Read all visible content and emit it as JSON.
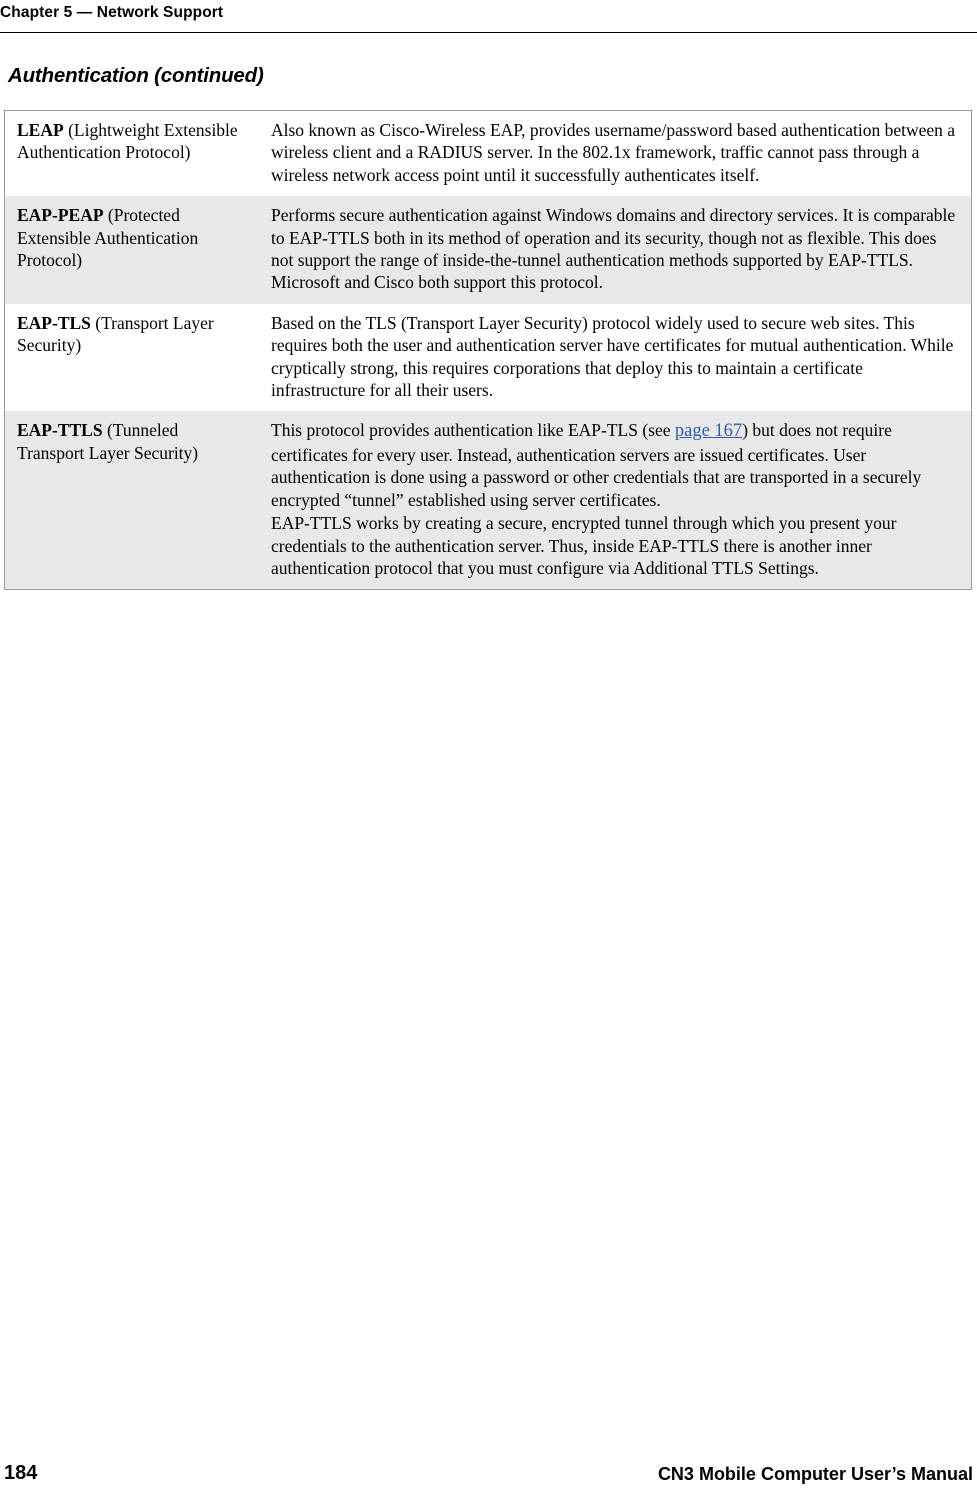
{
  "header": {
    "chapter": "Chapter 5 — Network Support"
  },
  "section": {
    "title": "Authentication (continued)"
  },
  "table": {
    "rows": [
      {
        "term_bold": "LEAP",
        "term_rest": " (Lightweight Extensible Authentication Protocol)",
        "paragraphs": [
          "Also known as Cisco-Wireless EAP, provides username/password based authentication between a wireless client and a RADIUS server. In the 802.1x framework, traffic cannot pass through a wireless network access point until it successfully authenticates itself."
        ],
        "shaded": false
      },
      {
        "term_bold": "EAP-PEAP",
        "term_rest": " (Protected Extensible Authentication Protocol)",
        "paragraphs": [
          "Performs secure authentication against Windows domains and directory services. It is comparable to EAP-TTLS both in its method of operation and its security, though not as flexible. This does not support the range of inside-the-tunnel authentication methods supported by EAP-TTLS. Microsoft and Cisco both support this protocol."
        ],
        "shaded": true
      },
      {
        "term_bold": "EAP-TLS",
        "term_rest": " (Transport Layer Security)",
        "paragraphs": [
          "Based on the TLS (Transport Layer Security) protocol widely used to secure web sites. This requires both the user and authentication server have certificates for mutual authentication. While cryptically strong, this requires corporations that deploy this to maintain a certificate infrastructure for all their users."
        ],
        "shaded": false
      },
      {
        "term_bold": "EAP-TTLS",
        "term_rest": " (Tunneled Transport Layer Security)",
        "paragraphs": [
          "This protocol provides authentication like EAP-TLS (see page 167) but does not require certificates for every user. Instead, authentication servers are issued certificates. User authentication is done using a password or other credentials that are transported in a securely encrypted “tunnel” established using server certificates.",
          "EAP-TTLS works by creating a secure, encrypted tunnel through which you present your credentials to the authentication server. Thus, inside EAP-TTLS there is another inner authentication protocol that you must configure via Additional TTLS Settings."
        ],
        "shaded": true
      }
    ],
    "crossref": {
      "prefix": "This protocol provides authentication like EAP-TLS (see ",
      "link": "page 167",
      "suffix": ") but does not require certificates for every user. Instead, authentication servers are issued certificates. User authentication is done using a password or other credentials that are transported in a securely encrypted “tunnel” established using server certificates."
    }
  },
  "footer": {
    "page_number": "184",
    "manual_title": "CN3 Mobile Computer User’s Manual"
  },
  "colors": {
    "link": "#2f5fa8",
    "shaded_row": "#e8e8e8",
    "border": "#9a9a9a"
  }
}
